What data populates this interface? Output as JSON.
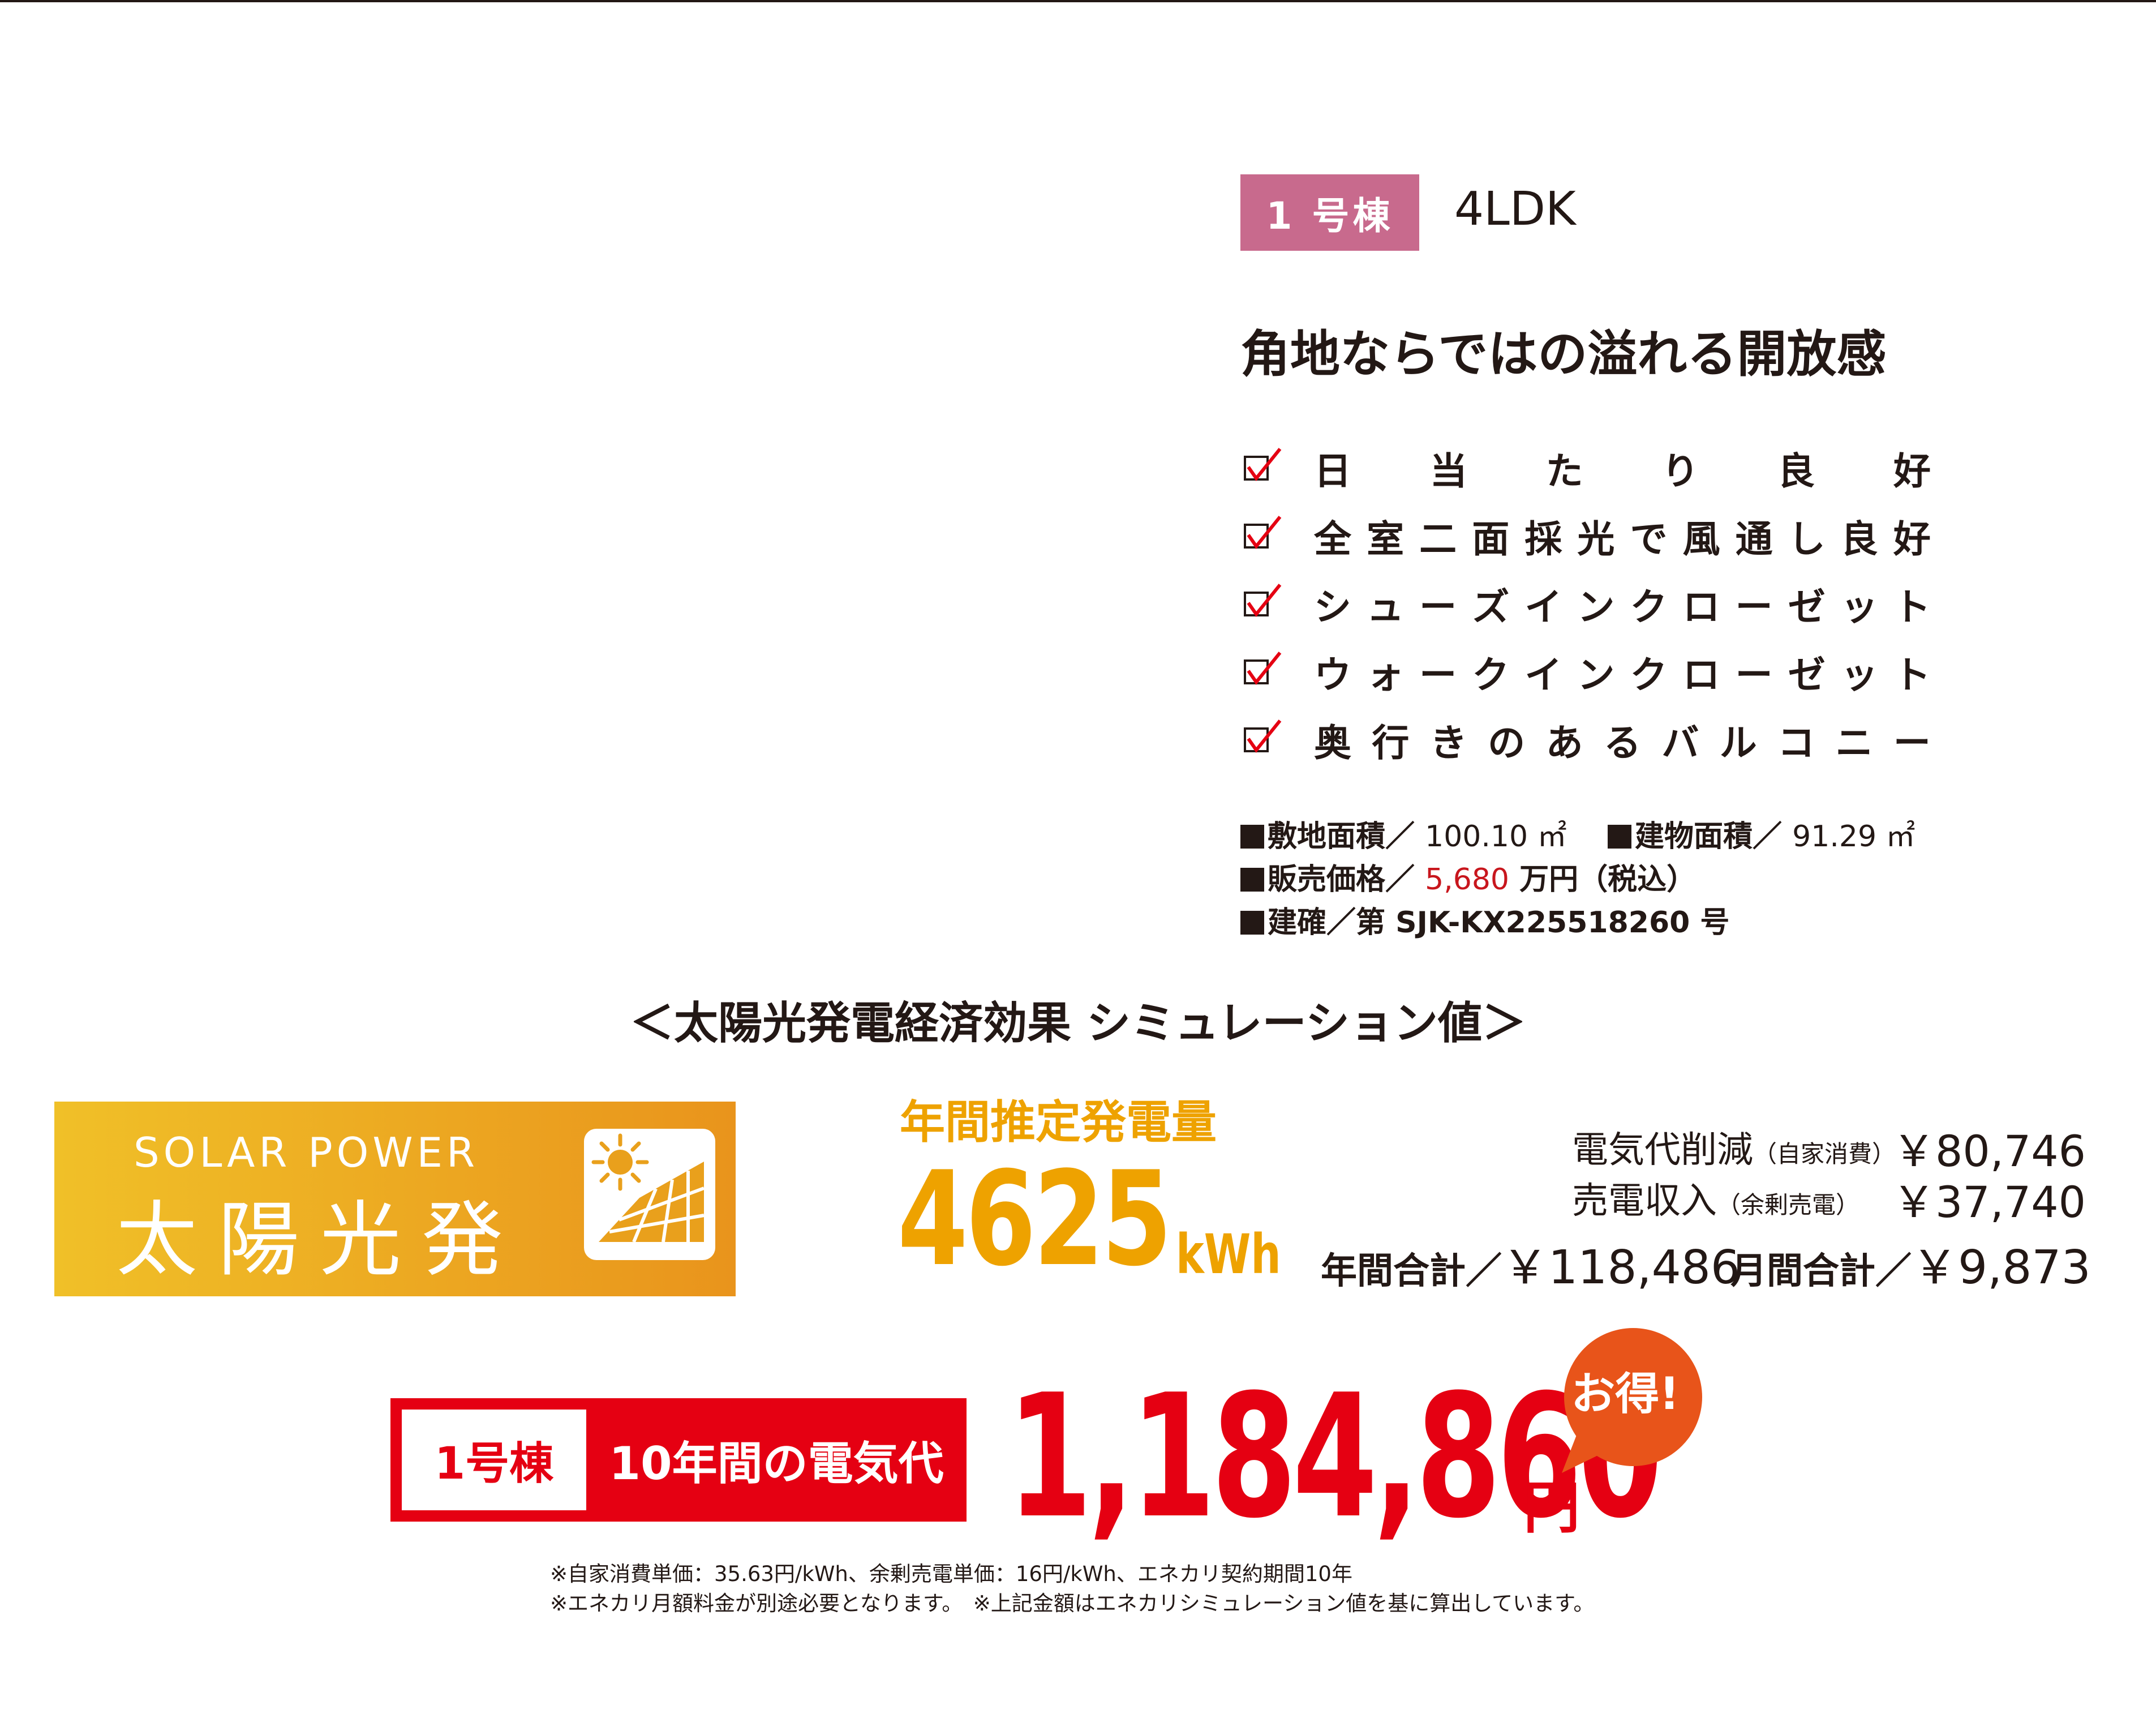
{
  "header": {
    "building_badge": "1 号棟",
    "floor_plan": "4LDK",
    "headline": "角地ならではの溢れる開放感"
  },
  "features": [
    "日 当 た り 良 好",
    "全室二面採光で風通し良好",
    "シューズインクローゼット",
    "ウォークインクローゼット",
    "奥行きのあるバルコニー"
  ],
  "specs": {
    "land_area_label": "敷地面積／",
    "land_area_value": "100.10 ㎡",
    "building_area_label": "建物面積／",
    "building_area_value": "91.29 ㎡",
    "price_label": "販売価格／",
    "price_value": "5,680",
    "price_suffix": "万円（税込）",
    "permit_label": "建確／第",
    "permit_value": "SJK-KX225518260",
    "permit_suffix": "号"
  },
  "simulation_title": "＜太陽光発電経済効果 シミュレーション値＞",
  "solar_banner": {
    "english": "SOLAR POWER",
    "japanese": "太陽光発電",
    "icon": "solar-panel-sun-icon"
  },
  "generation": {
    "label": "年間推定発電量",
    "value": "4625",
    "unit": "kWh"
  },
  "savings": {
    "electricity_reduction_label": "電気代削減",
    "electricity_reduction_note": "（自家消費）",
    "electricity_reduction_value": "￥80,746",
    "sales_income_label": "売電収入",
    "sales_income_note": "（余剰売電）",
    "sales_income_value": "￥37,740",
    "annual_total_label": "年間合計／",
    "annual_total_value": "￥118,486",
    "monthly_total_label": "月間合計／",
    "monthly_total_value": "￥9,873"
  },
  "ten_year": {
    "building": "1号棟",
    "label": "10年間の電気代",
    "amount": "1,184,860",
    "unit": "円",
    "bubble": "お得!"
  },
  "notes": [
    "※自家消費単価：35.63円/kWh、余剰売電単価：16円/kWh、エネカリ契約期間10年",
    "※エネカリ月額料金が別途必要となります。　※上記金額はエネカリシミュレーション値を基に算出しています。"
  ],
  "colors": {
    "badge_pink": "#c86a8d",
    "check_red": "#e50012",
    "price_red": "#c8161d",
    "gold": "#eea200",
    "banner_gold_light": "#f0c028",
    "banner_gold_dark": "#e9941c",
    "red": "#e50012",
    "bubble_orange": "#e8541a"
  }
}
